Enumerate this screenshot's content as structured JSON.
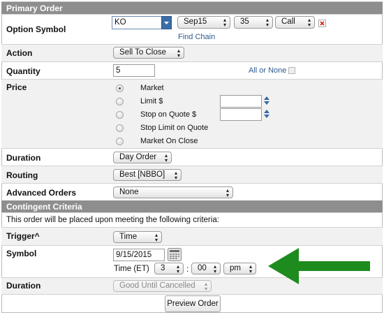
{
  "primary_order": {
    "header": "Primary Order",
    "option_symbol": {
      "label": "Option Symbol",
      "symbol_value": "KO",
      "expiry": "Sep15",
      "strike": "35",
      "type": "Call",
      "find_chain": "Find Chain"
    },
    "action": {
      "label": "Action",
      "value": "Sell To Close"
    },
    "quantity": {
      "label": "Quantity",
      "value": "5",
      "all_or_none": "All or None"
    },
    "price": {
      "label": "Price",
      "options": [
        "Market",
        "Limit $",
        "Stop on Quote $",
        "Stop Limit on Quote",
        "Market On Close"
      ],
      "selected": "Market"
    },
    "duration": {
      "label": "Duration",
      "value": "Day Order"
    },
    "routing": {
      "label": "Routing",
      "value": "Best [NBBO]"
    },
    "advanced_orders": {
      "label": "Advanced Orders",
      "value": "None"
    }
  },
  "contingent": {
    "header": "Contingent Criteria",
    "note": "This order will be placed upon meeting the following criteria:",
    "trigger": {
      "label": "Trigger^",
      "value": "Time"
    },
    "symbol": {
      "label": "Symbol",
      "date": "9/15/2015",
      "time_label": "Time (ET)",
      "hour": "3",
      "minute": "00",
      "ampm": "pm",
      "colon": ":"
    },
    "duration": {
      "label": "Duration",
      "value": "Good Until Cancelled"
    }
  },
  "preview_button": "Preview Order",
  "colors": {
    "header_bg": "#8e8e8e",
    "arrow": "#1e8b1e",
    "link": "#2b5a90",
    "spinner": "#3668a8"
  },
  "icons": [
    "chevron-down-icon",
    "close-icon",
    "calendar-icon",
    "spinner-icon",
    "arrow-left-icon"
  ]
}
